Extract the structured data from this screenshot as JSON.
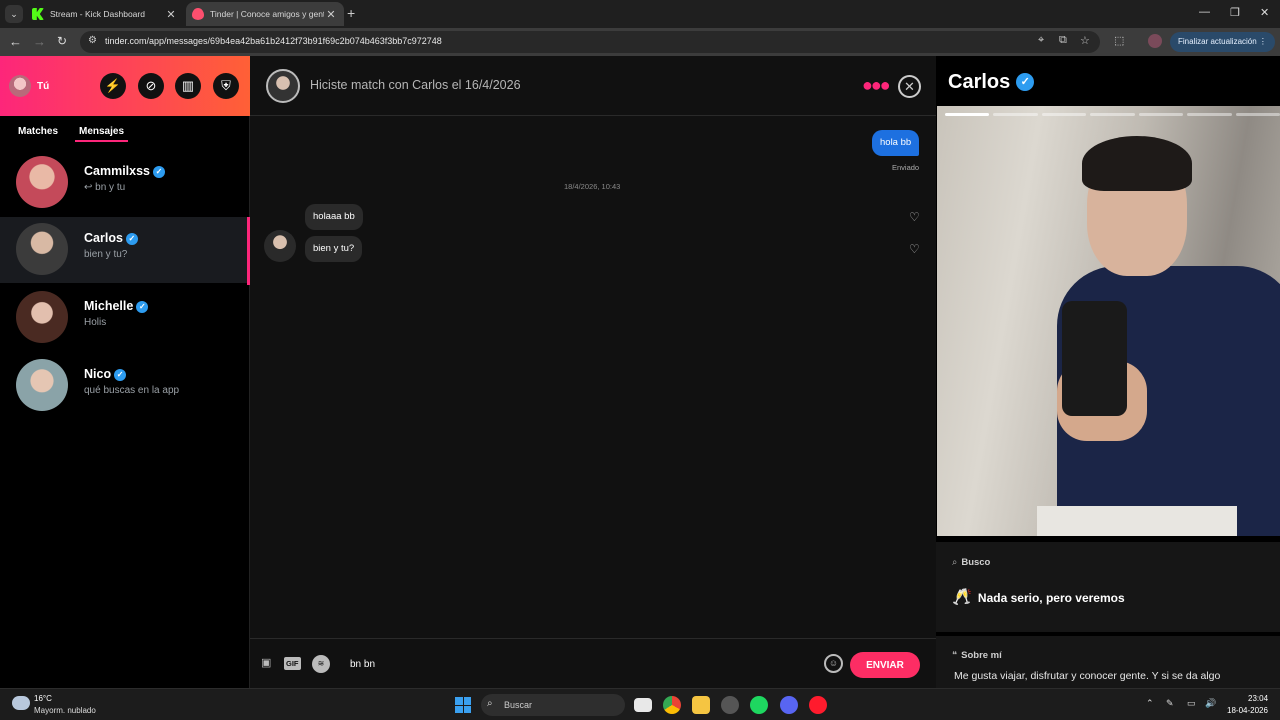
{
  "browser": {
    "tabs": [
      {
        "title": "Stream - Kick Dashboard",
        "favicon": "kick-icon"
      },
      {
        "title": "Tinder | Conoce amigos y gente",
        "favicon": "tinder-icon",
        "active": true
      }
    ],
    "url": "tinder.com/app/messages/69b4ea42ba61b2412f73b91f69c2b074b463f3bb7c972748",
    "update_button": "Finalizar actualización"
  },
  "sidebar": {
    "me_label": "Tú",
    "tabs": [
      "Matches",
      "Mensajes"
    ],
    "active_tab": "Mensajes",
    "conversations": [
      {
        "name": "Cammilxss",
        "preview": "↩ bn y tu",
        "verified": true
      },
      {
        "name": "Carlos",
        "preview": "bien y tu?",
        "verified": true,
        "selected": true
      },
      {
        "name": "Michelle",
        "preview": "Holis",
        "verified": true
      },
      {
        "name": "Nico",
        "preview": "qué buscas en la app",
        "verified": true
      }
    ]
  },
  "chat": {
    "header_title": "Hiciste match con Carlos el 16/4/2026",
    "messages": {
      "outgoing": {
        "text": "hola bb",
        "status": "Enviado"
      },
      "date_separator": "18/4/2026, 10:43",
      "incoming": [
        "holaaa bb",
        "bien y tu?"
      ]
    },
    "composer": {
      "value": "bn bn",
      "send_label": "ENVIAR",
      "gif_label": "GIF"
    }
  },
  "profile": {
    "name": "Carlos",
    "photo_count": 7,
    "photo_index": 1,
    "looking_for_label": "Busco",
    "looking_for_value": "Nada serio, pero veremos",
    "about_label": "Sobre mí",
    "about_text": "Me gusta viajar, disfrutar y conocer gente. Y si se da algo"
  },
  "taskbar": {
    "weather_temp": "16°C",
    "weather_desc": "Mayorm. nublado",
    "search_placeholder": "Buscar",
    "time": "23:04",
    "date": "18-04-2026"
  },
  "colors": {
    "brand_gradient_start": "#fd267a",
    "brand_gradient_end": "#ff6036",
    "outgoing_bubble": "#1d70e0",
    "send_button": "#fd2d64",
    "verified": "#2d9cf0"
  }
}
